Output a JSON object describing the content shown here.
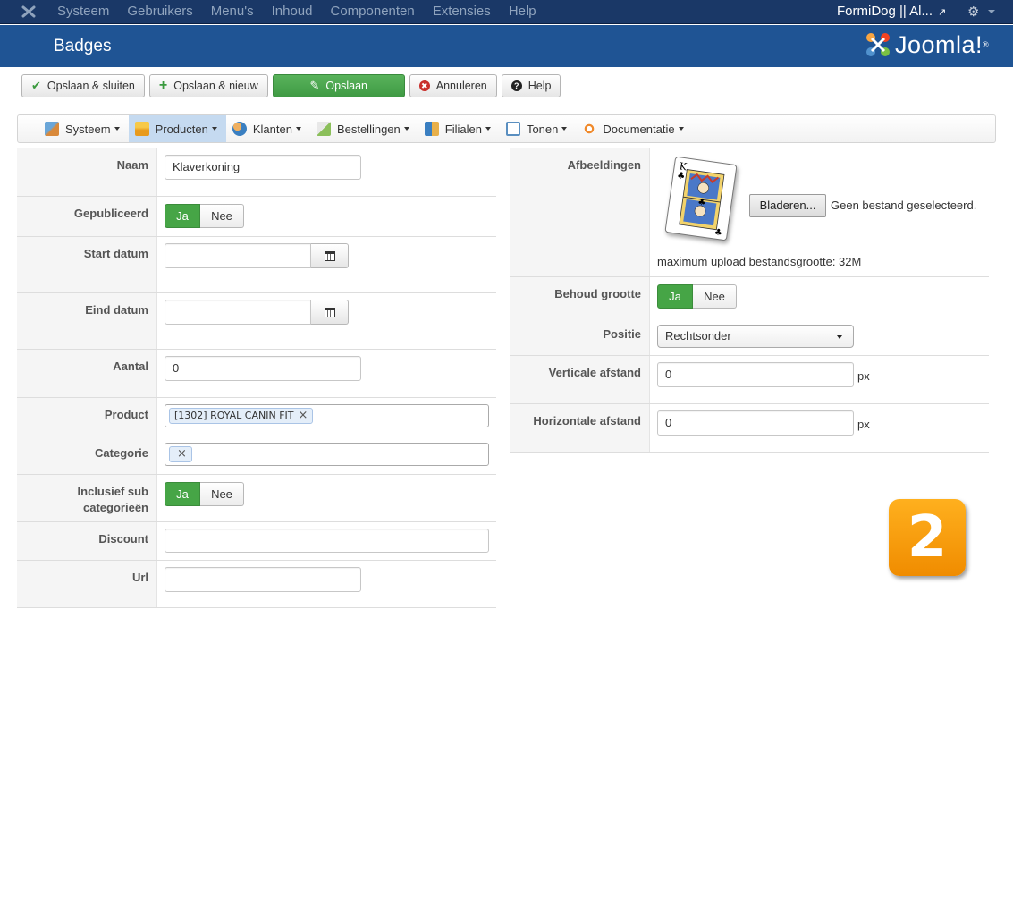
{
  "topbar": {
    "menu": [
      "Systeem",
      "Gebruikers",
      "Menu's",
      "Inhoud",
      "Componenten",
      "Extensies",
      "Help"
    ],
    "site_name": "FormiDog || Al...",
    "settings_icon": "gear-icon"
  },
  "header": {
    "title": "Badges",
    "brand": "Joomla!"
  },
  "toolbar": {
    "save_close": "Opslaan & sluiten",
    "save_new": "Opslaan & nieuw",
    "save": "Opslaan",
    "cancel": "Annuleren",
    "help": "Help"
  },
  "subnav": {
    "items": [
      {
        "label": "Systeem",
        "icon": "tools-icon"
      },
      {
        "label": "Producten",
        "icon": "box-icon",
        "active": true
      },
      {
        "label": "Klanten",
        "icon": "users-icon"
      },
      {
        "label": "Bestellingen",
        "icon": "orders-icon"
      },
      {
        "label": "Filialen",
        "icon": "stores-icon"
      },
      {
        "label": "Tonen",
        "icon": "display-icon"
      },
      {
        "label": "Documentatie",
        "icon": "docs-icon"
      }
    ]
  },
  "form_left": {
    "naam": {
      "label": "Naam",
      "value": "Klaverkoning"
    },
    "gepubliceerd": {
      "label": "Gepubliceerd",
      "yes": "Ja",
      "no": "Nee",
      "selected": "Ja"
    },
    "start_datum": {
      "label": "Start datum",
      "value": ""
    },
    "eind_datum": {
      "label": "Eind datum",
      "value": ""
    },
    "aantal": {
      "label": "Aantal",
      "value": "0"
    },
    "product": {
      "label": "Product",
      "chip": "[1302] ROYAL CANIN FIT"
    },
    "categorie": {
      "label": "Categorie"
    },
    "inclusief": {
      "label_1": "Inclusief sub",
      "label_2": "categorieën",
      "yes": "Ja",
      "no": "Nee",
      "selected": "Ja"
    },
    "discount": {
      "label": "Discount",
      "value": ""
    },
    "url": {
      "label": "Url",
      "value": ""
    }
  },
  "form_right": {
    "afbeeldingen": {
      "label": "Afbeeldingen",
      "browse": "Bladeren...",
      "no_file": "Geen bestand geselecteerd.",
      "max_upload": "maximum upload bestandsgrootte: 32M"
    },
    "behoud_grootte": {
      "label": "Behoud grootte",
      "yes": "Ja",
      "no": "Nee",
      "selected": "Ja"
    },
    "positie": {
      "label": "Positie",
      "value": "Rechtsonder"
    },
    "verticale": {
      "label": "Verticale afstand",
      "value": "0",
      "unit": "px"
    },
    "horizontale": {
      "label": "Horizontale afstand",
      "value": "0",
      "unit": "px"
    }
  },
  "step_badge": "2",
  "colors": {
    "topbar": "#1a3867",
    "header": "#1f5494",
    "success": "#46a546",
    "step_badge": "#f7a10c"
  }
}
